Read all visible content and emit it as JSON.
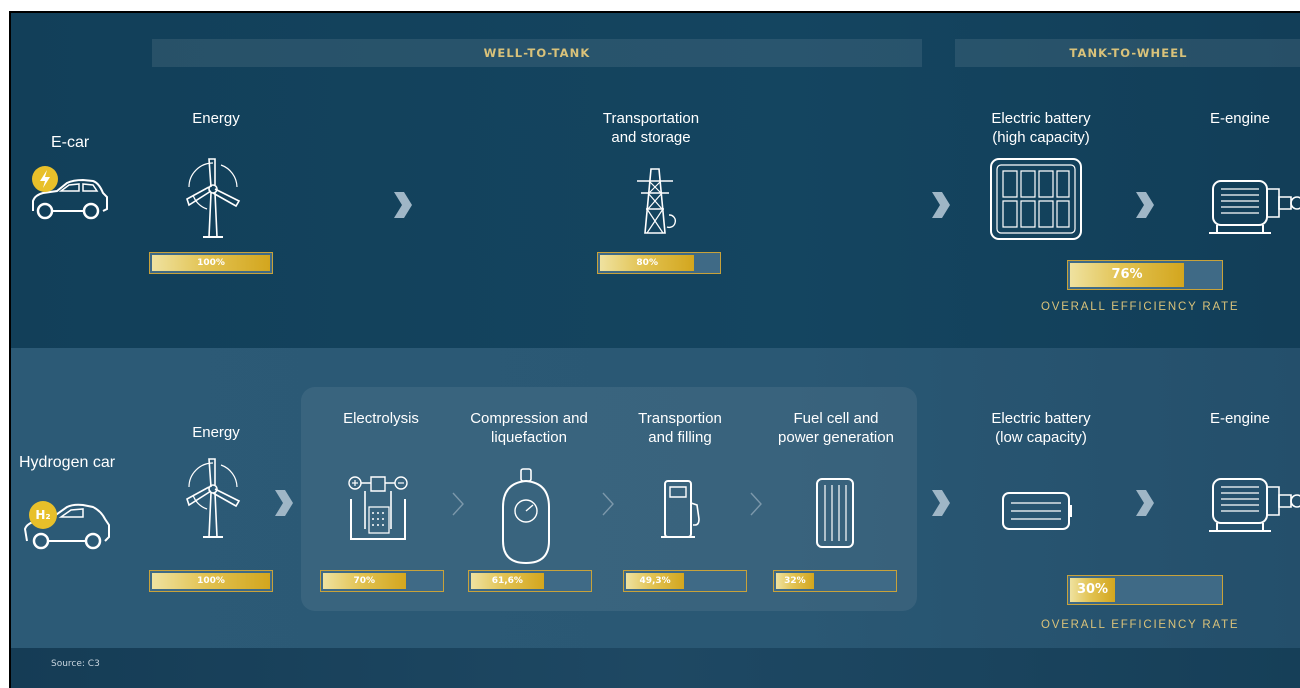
{
  "headers": {
    "well_to_tank": "WELL-TO-TANK",
    "tank_to_wheel": "TANK-TO-WHEEL"
  },
  "ecar": {
    "name": "E-car",
    "badge_icon": "lightning-icon",
    "steps": [
      {
        "label": "Energy",
        "icon": "wind-turbine-icon",
        "value_text": "100%",
        "value": 100
      },
      {
        "label": "Transportation\nand storage",
        "icon": "power-pylon-icon",
        "value_text": "80%",
        "value": 80
      },
      {
        "label": "Electric battery\n(high capacity)",
        "icon": "large-battery-icon"
      },
      {
        "label": "E-engine",
        "icon": "electric-motor-icon"
      }
    ],
    "overall": {
      "value_text": "76%",
      "value": 76,
      "label": "OVERALL EFFICIENCY RATE"
    }
  },
  "hydrogen": {
    "name": "Hydrogen car",
    "badge_text": "H₂",
    "steps": [
      {
        "label": "Energy",
        "icon": "wind-turbine-icon",
        "value_text": "100%",
        "value": 100
      },
      {
        "label": "Electrolysis",
        "icon": "electrolysis-icon",
        "value_text": "70%",
        "value": 70
      },
      {
        "label": "Compression and\nliquefaction",
        "icon": "gas-tank-icon",
        "value_text": "61,6%",
        "value": 61.6
      },
      {
        "label": "Transportion\nand filling",
        "icon": "fuel-pump-icon",
        "value_text": "49,3%",
        "value": 49.3
      },
      {
        "label": "Fuel cell and\npower generation",
        "icon": "fuel-cell-icon",
        "value_text": "32%",
        "value": 32
      },
      {
        "label": "Electric battery\n(low capacity)",
        "icon": "small-battery-icon"
      },
      {
        "label": "E-engine",
        "icon": "electric-motor-icon"
      }
    ],
    "overall": {
      "value_text": "30%",
      "value": 30,
      "label": "OVERALL EFFICIENCY RATE"
    }
  },
  "source": "Source: C3",
  "colors": {
    "bar_fill": "#d8ae2e",
    "bar_track": "#3f6a86",
    "accent_gold": "#d9c27a",
    "background": "#134560"
  }
}
